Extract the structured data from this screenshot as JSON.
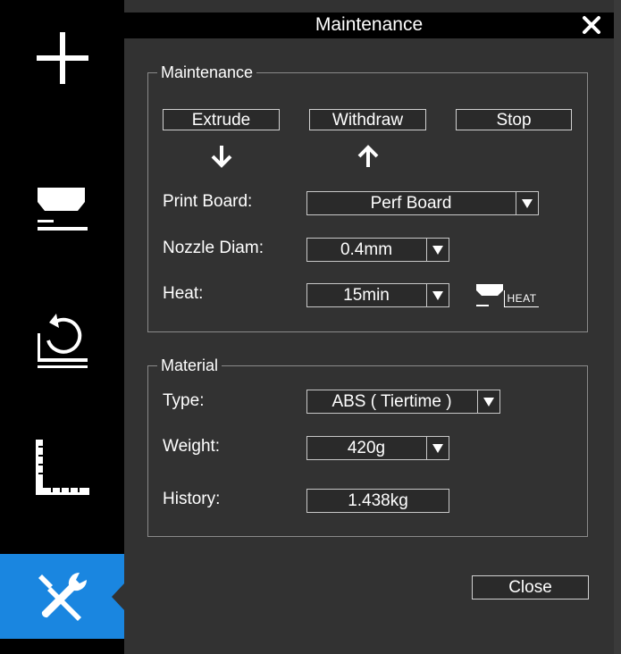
{
  "window": {
    "title": "Maintenance"
  },
  "sidebar": {
    "items": [
      {
        "name": "add",
        "icon": "plus-icon"
      },
      {
        "name": "print",
        "icon": "nozzle-platform-icon"
      },
      {
        "name": "calibrate",
        "icon": "reset-platform-icon"
      },
      {
        "name": "measure",
        "icon": "ruler-corner-icon"
      },
      {
        "name": "maintenance",
        "icon": "wrench-screwdriver-icon",
        "active": true
      }
    ],
    "active_color": "#1a86e0"
  },
  "maintenance_group": {
    "legend": "Maintenance",
    "extrude_label": "Extrude",
    "withdraw_label": "Withdraw",
    "stop_label": "Stop",
    "print_board_label": "Print Board:",
    "print_board_value": "Perf Board",
    "nozzle_label": "Nozzle Diam:",
    "nozzle_value": "0.4mm",
    "heat_label": "Heat:",
    "heat_value": "15min",
    "heat_icon_text": "HEAT"
  },
  "material_group": {
    "legend": "Material",
    "type_label": "Type:",
    "type_value": "ABS ( Tiertime )",
    "weight_label": "Weight:",
    "weight_value": "420g",
    "history_label": "History:",
    "history_value": "1.438kg"
  },
  "footer": {
    "close_label": "Close"
  }
}
